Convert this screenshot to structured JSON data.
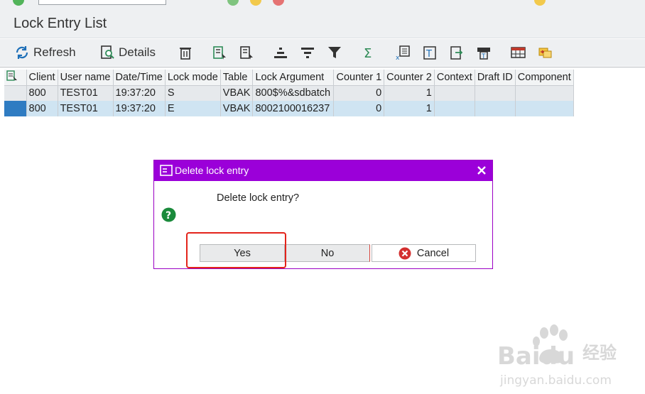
{
  "page": {
    "title": "Lock Entry List"
  },
  "toolbar": {
    "refresh_label": "Refresh",
    "details_label": "Details",
    "icons": [
      "refresh-icon",
      "details-icon",
      "delete-icon",
      "select-all-icon",
      "deselect-all-icon",
      "sort-ascending-icon",
      "sort-descending-icon",
      "filter-icon",
      "sum-icon",
      "export-excel-icon",
      "print-preview-icon",
      "export-icon",
      "print-icon",
      "layout-icon",
      "settings-icon"
    ]
  },
  "table": {
    "columns": [
      "Client",
      "User name",
      "Date/Time",
      "Lock mode",
      "Table",
      "Lock Argument",
      "Counter 1",
      "Counter 2",
      "Context",
      "Draft ID",
      "Component"
    ],
    "rows": [
      {
        "client": "800",
        "user": "TEST01",
        "time": "19:37:20",
        "mode": "S",
        "table": "VBAK",
        "argument": "800$%&sdbatch",
        "counter1": "0",
        "counter2": "1",
        "context": "",
        "draft_id": "",
        "component": ""
      },
      {
        "client": "800",
        "user": "TEST01",
        "time": "19:37:20",
        "mode": "E",
        "table": "VBAK",
        "argument": "8002100016237",
        "counter1": "0",
        "counter2": "1",
        "context": "",
        "draft_id": "",
        "component": ""
      }
    ],
    "selected_row": 1
  },
  "dialog": {
    "title": "Delete lock entry",
    "message": "Delete lock entry?",
    "yes_label": "Yes",
    "no_label": "No",
    "cancel_label": "Cancel"
  },
  "watermark": {
    "brand": "Baidu",
    "brand_cn": "经验",
    "url": "jingyan.baidu.com"
  },
  "colors": {
    "dialog_title_bg": "#9b00d9",
    "selected_row_bg": "#cfe4f2",
    "highlight_border": "#e3241b"
  }
}
